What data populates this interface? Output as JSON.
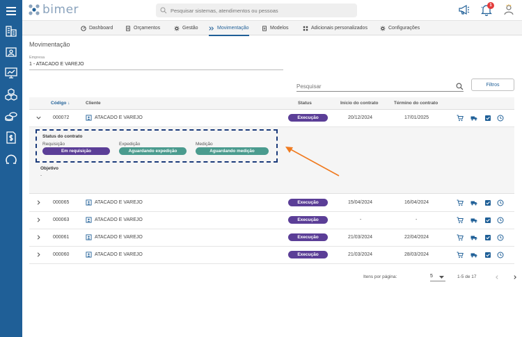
{
  "header": {
    "logo_text": "bimer",
    "search_placeholder": "Pesquisar sistemas, atendimentos ou pessoas",
    "notification_count": "1"
  },
  "tabs": [
    {
      "label": "Dashboard",
      "icon": "dashboard-icon"
    },
    {
      "label": "Orçamentos",
      "icon": "document-icon"
    },
    {
      "label": "Gestão",
      "icon": "gear-icon"
    },
    {
      "label": "Movimentação",
      "icon": "movement-icon",
      "active": true
    },
    {
      "label": "Modelos",
      "icon": "document-icon"
    },
    {
      "label": "Adicionais personalizados",
      "icon": "grid-icon"
    },
    {
      "label": "Configurações",
      "icon": "gear-icon"
    }
  ],
  "page": {
    "title": "Movimentação",
    "empresa_label": "Empresa",
    "empresa_value": "1 - ATACADO E VAREJO",
    "search_placeholder": "Pesquisar",
    "filters_label": "Filtros"
  },
  "table": {
    "headers": {
      "codigo": "Código",
      "cliente": "Cliente",
      "status": "Status",
      "inicio": "Início do contrato",
      "termino": "Término do contrato"
    },
    "rows": [
      {
        "codigo": "000072",
        "cliente": "ATACADO E VAREJO",
        "status": "Execução",
        "inicio": "20/12/2024",
        "termino": "17/01/2025",
        "expanded": true
      },
      {
        "codigo": "000065",
        "cliente": "ATACADO E VAREJO",
        "status": "Execução",
        "inicio": "15/04/2024",
        "termino": "16/04/2024"
      },
      {
        "codigo": "000063",
        "cliente": "ATACADO E VAREJO",
        "status": "Execução",
        "inicio": "-",
        "termino": "-"
      },
      {
        "codigo": "000061",
        "cliente": "ATACADO E VAREJO",
        "status": "Execução",
        "inicio": "21/03/2024",
        "termino": "22/04/2024"
      },
      {
        "codigo": "000060",
        "cliente": "ATACADO E VAREJO",
        "status": "Execução",
        "inicio": "21/03/2024",
        "termino": "28/03/2024"
      }
    ]
  },
  "expanded_detail": {
    "status_title": "Status do contrato",
    "requisicao_label": "Requisição",
    "requisicao_value": "Em requisição",
    "expedicao_label": "Expedição",
    "expedicao_value": "Aguardando expedição",
    "medicao_label": "Medição",
    "medicao_value": "Aguardando medição",
    "objetivo_label": "Objetivo",
    "objetivo_value": "-"
  },
  "pagination": {
    "items_per_page_label": "Itens por página:",
    "items_per_page": "5",
    "range": "1-5 de 17"
  },
  "colors": {
    "sidebar": "#1f5f97",
    "status_purple": "#5b3e97",
    "status_teal": "#4a9b8e",
    "annotation_orange": "#f07a1f",
    "annotation_navy": "#1a3a7a"
  }
}
